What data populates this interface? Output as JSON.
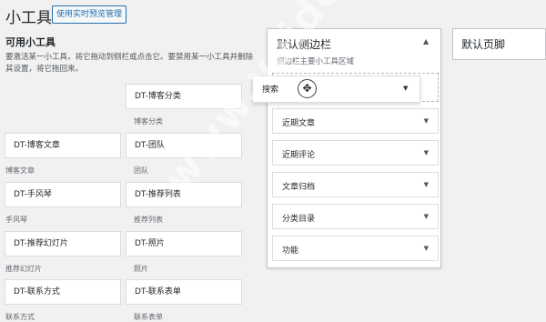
{
  "header": {
    "title": "小工具",
    "manage_button": "使用实时预览管理"
  },
  "available": {
    "title": "可用小工具",
    "description": "要激活某一小工具，将它拖动到侧栏或点击它。要禁用某一小工具并删除其设置，将它拖回来。"
  },
  "widgets": [
    {
      "title": "DT-博客分类",
      "desc": "博客分类"
    },
    {
      "title": "DT-博客文章",
      "desc": "博客文章"
    },
    {
      "title": "DT-团队",
      "desc": "团队"
    },
    {
      "title": "DT-手风琴",
      "desc": "手风琴"
    },
    {
      "title": "DT-推荐列表",
      "desc": "推荐列表"
    },
    {
      "title": "DT-推荐幻灯片",
      "desc": "推荐幻灯片"
    },
    {
      "title": "DT-照片",
      "desc": "照片"
    },
    {
      "title": "DT-联系方式",
      "desc": "联系方式"
    },
    {
      "title": "DT-联系表单",
      "desc": "联系表单"
    }
  ],
  "sidebar": {
    "title": "默认侧边栏",
    "description": "侧边栏主要小工具区域",
    "dragging_widget": "搜索",
    "items": [
      "近期文章",
      "近期评论",
      "文章归档",
      "分类目录",
      "功能"
    ]
  },
  "footer": {
    "title": "默认页脚"
  },
  "watermark": "www.veidc.com",
  "icons": {
    "collapse": "triangle-up-icon",
    "expand": "triangle-down-icon",
    "cursor": "move-cursor-icon"
  },
  "colors": {
    "accent": "#2271b1",
    "background": "#f1f1f1"
  }
}
